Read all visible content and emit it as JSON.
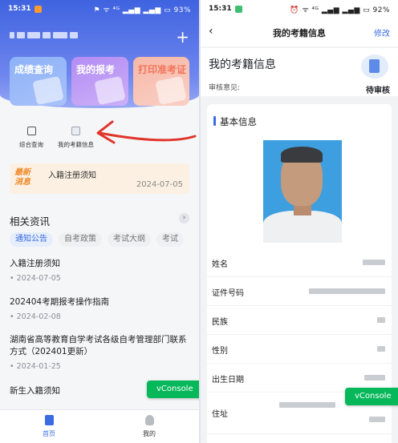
{
  "left": {
    "status": {
      "time": "15:31",
      "right": "⚑ ᯤ ⁴ᴳ ▂▄▆ ▂▄▆ ▭ 93%"
    },
    "header": {
      "plus_icon": "+"
    },
    "tiles": [
      {
        "label": "成绩查询"
      },
      {
        "label": "我的报考"
      },
      {
        "label": "打印准考证"
      }
    ],
    "quick_links": [
      {
        "label": "综合查询",
        "icon": "document-icon"
      },
      {
        "label": "我的考籍信息",
        "icon": "image-icon"
      }
    ],
    "notice": {
      "badge_line1": "最新",
      "badge_line2": "消息",
      "title": "入籍注册须知",
      "date": "2024-07-05"
    },
    "section": {
      "title": "相关资讯",
      "arrow": "›"
    },
    "chips": [
      "通知公告",
      "自考政策",
      "考试大纲",
      "考试"
    ],
    "news": [
      {
        "title": "入籍注册须知",
        "date": "2024-07-05"
      },
      {
        "title": "202404考期报考操作指南",
        "date": "2024-02-08"
      },
      {
        "title": "湖南省高等教育自学考试各级自考管理部门联系方式（202401更新）",
        "date": "2024-01-25"
      },
      {
        "title": "新生入籍须知",
        "date": ""
      }
    ],
    "vconsole": "vConsole",
    "tabbar": {
      "home": "首页",
      "mine": "我的"
    }
  },
  "right": {
    "status": {
      "time": "15:31",
      "right": "⏰ ᯤ ⁴ᴳ ▂▄▆ ▂▄▆ ▭ 92%"
    },
    "nav": {
      "back": "‹",
      "title": "我的考籍信息",
      "edit": "修改"
    },
    "head": {
      "title": "我的考籍信息",
      "review_label": "审核意见:",
      "status": "待审核"
    },
    "card_title": "基本信息",
    "fields": [
      {
        "label": "姓名"
      },
      {
        "label": "证件号码"
      },
      {
        "label": "民族"
      },
      {
        "label": "性别"
      },
      {
        "label": "出生日期"
      },
      {
        "label": "住址"
      }
    ],
    "vconsole": "vConsole"
  },
  "colors": {
    "primary": "#3b6be0",
    "vconsole": "#07b85a",
    "annotation_arrow": "#e0352b",
    "notice_orange": "#f08a2a"
  }
}
